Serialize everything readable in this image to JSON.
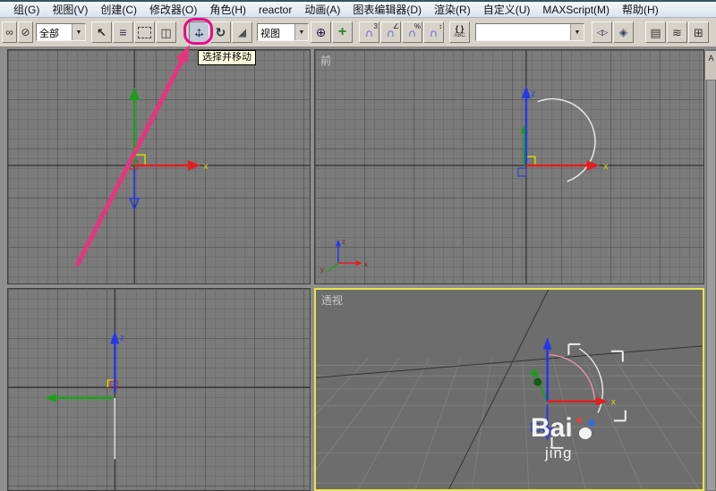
{
  "menu_bar": {
    "items": [
      "组(G)",
      "视图(V)",
      "创建(C)",
      "修改器(O)",
      "角色(H)",
      "reactor",
      "动画(A)",
      "图表编辑器(D)",
      "渲染(R)",
      "自定义(U)",
      "MAXScript(M)",
      "帮助(H)"
    ]
  },
  "toolbar": {
    "tooltip": "选择并移动",
    "items": [
      {
        "type": "button",
        "name": "select-and-link-button",
        "icon": "link"
      },
      {
        "type": "button",
        "name": "unlink-selection-button",
        "icon": "unlink"
      },
      {
        "type": "dropdown",
        "name": "selection-filter-dropdown",
        "value": "全部"
      },
      {
        "type": "button",
        "name": "select-object-button",
        "icon": "select-arrow"
      },
      {
        "type": "button",
        "name": "select-by-name-button",
        "icon": "select-by-name"
      },
      {
        "type": "button",
        "name": "rectangular-selection-button",
        "icon": "marquee"
      },
      {
        "type": "button",
        "name": "window-crossing-button",
        "icon": "window-crossing"
      },
      {
        "type": "button",
        "name": "select-and-move-button",
        "icon": "move",
        "active": true
      },
      {
        "type": "button",
        "name": "select-and-rotate-button",
        "icon": "rotate"
      },
      {
        "type": "button",
        "name": "select-and-scale-button",
        "icon": "scale"
      },
      {
        "type": "dropdown",
        "name": "reference-coordinate-dropdown",
        "value": "视图"
      },
      {
        "type": "button",
        "name": "use-center-button",
        "icon": "use-center"
      },
      {
        "type": "button",
        "name": "select-and-manipulate-button",
        "icon": "manipulate"
      },
      {
        "type": "button",
        "name": "snap-toggle-button",
        "icon": "snap-3",
        "sup": "3"
      },
      {
        "type": "button",
        "name": "angle-snap-button",
        "icon": "snap-angle",
        "sup": "∠"
      },
      {
        "type": "button",
        "name": "percent-snap-button",
        "icon": "snap-percent",
        "sup": "%"
      },
      {
        "type": "button",
        "name": "spinner-snap-button",
        "icon": "snap-spinner",
        "sup": "↕"
      },
      {
        "type": "button",
        "name": "named-selection-sets-button",
        "icon": "named-sets"
      },
      {
        "type": "dropdown",
        "name": "named-selection-dropdown",
        "value": ""
      },
      {
        "type": "button",
        "name": "mirror-button",
        "icon": "mirror"
      },
      {
        "type": "button",
        "name": "align-button",
        "icon": "align"
      },
      {
        "type": "button",
        "name": "layer-manager-button",
        "icon": "layers"
      },
      {
        "type": "button",
        "name": "curve-editor-button",
        "icon": "curve-editor"
      },
      {
        "type": "button",
        "name": "schematic-view-button",
        "icon": "schematic"
      }
    ]
  },
  "viewports": {
    "top_left": {
      "label": ""
    },
    "front": {
      "label": "前"
    },
    "left_view": {
      "label": ""
    },
    "perspective": {
      "label": "透视"
    }
  },
  "axis_labels": {
    "x": "x",
    "y": "y",
    "z": "z"
  },
  "watermark": {
    "line1": "Bai",
    "line2": "jing"
  },
  "right_panel": {
    "tab_label": "A"
  },
  "colors": {
    "highlight_ring": "#e70b8c",
    "annotation_arrow": "#e5357f",
    "active_viewport_border": "#e9e44c",
    "tooltip_bg": "#ffffdf",
    "axis_x": "#e02020",
    "axis_y": "#18a018",
    "axis_z": "#2438e8"
  }
}
